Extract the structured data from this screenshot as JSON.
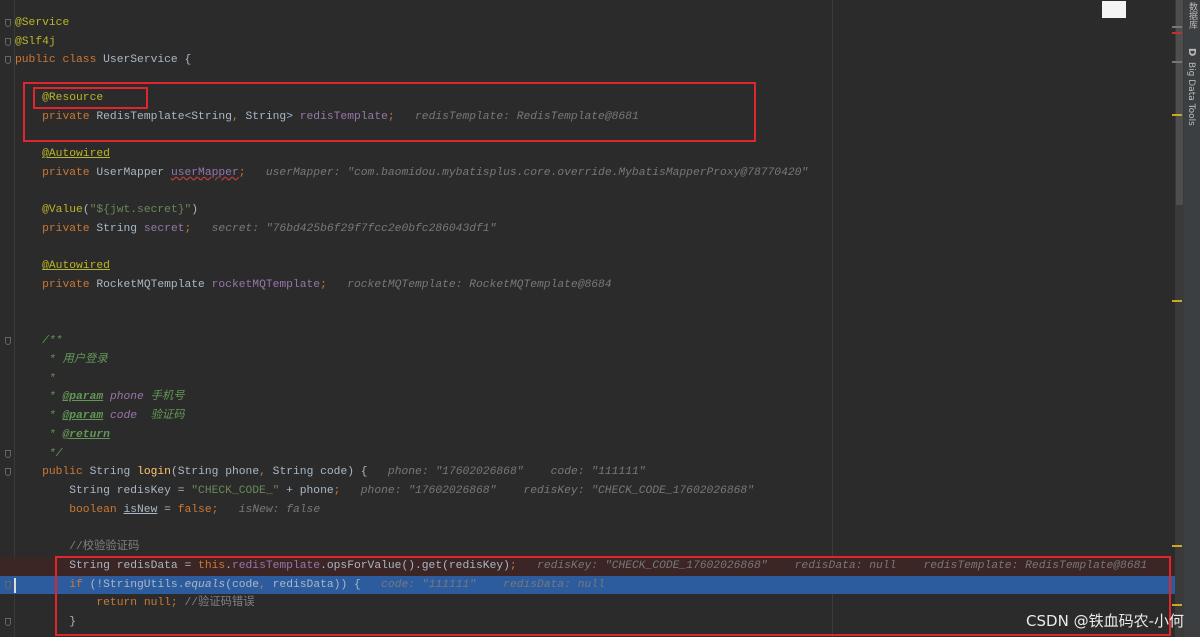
{
  "lines": [
    [
      [
        "a",
        "@Service"
      ]
    ],
    [
      [
        "a",
        "@Slf4j"
      ]
    ],
    [
      [
        "k",
        "public class "
      ],
      [
        "",
        "UserService {"
      ]
    ],
    [],
    [
      [
        "",
        "    "
      ],
      [
        "a",
        "@Resource"
      ]
    ],
    [
      [
        "",
        "    "
      ],
      [
        "k",
        "private "
      ],
      [
        "",
        "RedisTemplate<String"
      ],
      [
        "k",
        ", "
      ],
      [
        "",
        "String> "
      ],
      [
        "f",
        "redisTemplate"
      ],
      [
        "k",
        ";"
      ],
      [
        "h",
        "   redisTemplate: RedisTemplate@8681"
      ]
    ],
    [],
    [
      [
        "",
        "    "
      ],
      [
        "a u",
        "@Autowired"
      ]
    ],
    [
      [
        "",
        "    "
      ],
      [
        "k",
        "private "
      ],
      [
        "",
        "UserMapper "
      ],
      [
        "f w",
        "userMapper"
      ],
      [
        "k",
        ";"
      ],
      [
        "h",
        "   userMapper: \"com.baomidou.mybatisplus.core.override.MybatisMapperProxy@78770420\""
      ]
    ],
    [],
    [
      [
        "",
        "    "
      ],
      [
        "a",
        "@Value"
      ],
      [
        "",
        "("
      ],
      [
        "s",
        "\"${jwt.secret}\""
      ],
      [
        "",
        ")"
      ]
    ],
    [
      [
        "",
        "    "
      ],
      [
        "k",
        "private "
      ],
      [
        "",
        "String "
      ],
      [
        "f",
        "secret"
      ],
      [
        "k",
        ";"
      ],
      [
        "h",
        "   secret: \"76bd425b6f29f7fcc2e0bfc286043df1\""
      ]
    ],
    [],
    [
      [
        "",
        "    "
      ],
      [
        "a u",
        "@Autowired"
      ]
    ],
    [
      [
        "",
        "    "
      ],
      [
        "k",
        "private "
      ],
      [
        "",
        "RocketMQTemplate "
      ],
      [
        "f",
        "rocketMQTemplate"
      ],
      [
        "k",
        ";"
      ],
      [
        "h",
        "   rocketMQTemplate: RocketMQTemplate@8684"
      ]
    ],
    [],
    [],
    [
      [
        "",
        "    "
      ],
      [
        "d",
        "/**"
      ]
    ],
    [
      [
        "",
        "    "
      ],
      [
        "d",
        " * 用户登录"
      ]
    ],
    [
      [
        "",
        "    "
      ],
      [
        "d",
        " *"
      ]
    ],
    [
      [
        "",
        "    "
      ],
      [
        "d",
        " * "
      ],
      [
        "dt",
        "@param"
      ],
      [
        "d",
        " "
      ],
      [
        "f it",
        "phone"
      ],
      [
        "d",
        " 手机号"
      ]
    ],
    [
      [
        "",
        "    "
      ],
      [
        "d",
        " * "
      ],
      [
        "dt",
        "@param"
      ],
      [
        "d",
        " "
      ],
      [
        "f it",
        "code"
      ],
      [
        "d",
        "  验证码"
      ]
    ],
    [
      [
        "",
        "    "
      ],
      [
        "d",
        " * "
      ],
      [
        "dt",
        "@return"
      ]
    ],
    [
      [
        "",
        "    "
      ],
      [
        "d",
        " */"
      ]
    ],
    [
      [
        "",
        "    "
      ],
      [
        "k",
        "public "
      ],
      [
        "",
        "String "
      ],
      [
        "m",
        "login"
      ],
      [
        "",
        "(String phone"
      ],
      [
        "k",
        ", "
      ],
      [
        "",
        "String code) {"
      ],
      [
        "h",
        "   phone: \"17602026868\"    code: \"111111\""
      ]
    ],
    [
      [
        "",
        "        String redisKey = "
      ],
      [
        "s",
        "\"CHECK_CODE_\""
      ],
      [
        "",
        " + phone"
      ],
      [
        "k",
        ";"
      ],
      [
        "h",
        "   phone: \"17602026868\"    redisKey: \"CHECK_CODE_17602026868\""
      ]
    ],
    [
      [
        "",
        "        "
      ],
      [
        "k",
        "boolean "
      ],
      [
        "u",
        "isNew"
      ],
      [
        "",
        " = "
      ],
      [
        "k",
        "false;"
      ],
      [
        "h",
        "   isNew: false"
      ]
    ],
    [],
    [
      [
        "",
        "        "
      ],
      [
        "c",
        "//校验验证码"
      ]
    ],
    [
      [
        "",
        "        String redisData = "
      ],
      [
        "k",
        "this"
      ],
      [
        "",
        "."
      ],
      [
        "f",
        "redisTemplate"
      ],
      [
        "",
        ".opsForValue().get(redisKey)"
      ],
      [
        "k",
        ";"
      ],
      [
        "h",
        "   redisKey: \"CHECK_CODE_17602026868\"    redisData: null    redisTemplate: RedisTemplate@8681"
      ]
    ],
    [
      [
        "",
        "        "
      ],
      [
        "k",
        "if "
      ],
      [
        "",
        "(!StringUtils."
      ],
      [
        "it",
        "equals"
      ],
      [
        "",
        "(code"
      ],
      [
        "k",
        ", "
      ],
      [
        "",
        "redisData)) {"
      ],
      [
        "h",
        "   code: \"111111\"    redisData: null"
      ]
    ],
    [
      [
        "",
        "            "
      ],
      [
        "k",
        "return null; "
      ],
      [
        "c",
        "//验证码错误"
      ]
    ],
    [
      [
        "",
        "        }"
      ]
    ]
  ],
  "sidebar": {
    "database_label": "数据库",
    "bigdata_label": "Big Data Tools",
    "bigdata_icon": "D"
  },
  "watermark": "CSDN @铁血码农-小何",
  "colors": {
    "background": "#2b2b2b",
    "execution_line": "#2d5c9e",
    "breakpoint_line": "#3b2525",
    "highlight_box": "#e0262c"
  }
}
